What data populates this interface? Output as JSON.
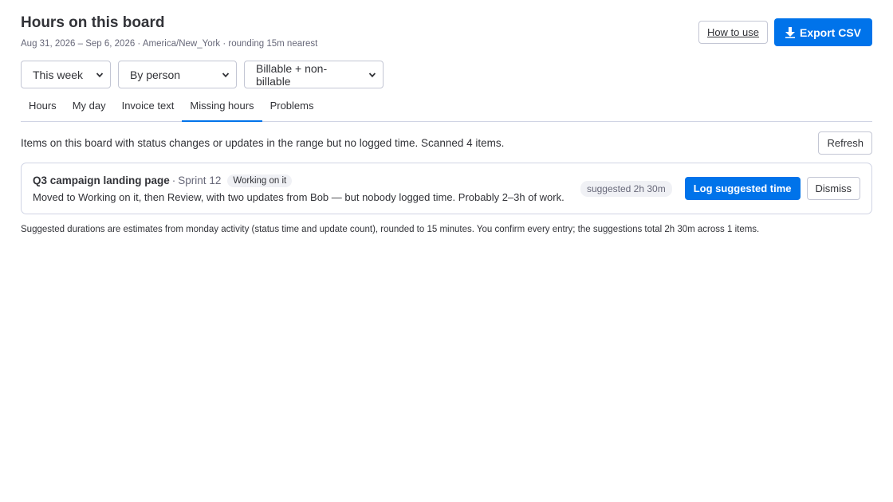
{
  "header": {
    "title": "Hours on this board",
    "subtitle": "Aug 31, 2026 – Sep 6, 2026 · America/New_York · rounding 15m nearest",
    "how_to_use_label": "How to use",
    "export_label": "Export CSV"
  },
  "filters": {
    "range": "This week",
    "group_by": "By person",
    "billable": "Billable + non-billable"
  },
  "tabs": [
    {
      "label": "Hours"
    },
    {
      "label": "My day"
    },
    {
      "label": "Invoice text"
    },
    {
      "label": "Missing hours"
    },
    {
      "label": "Problems"
    }
  ],
  "active_tab": "Missing hours",
  "missing": {
    "info": "Items on this board with status changes or updates in the range but no logged time. Scanned 4 items.",
    "refresh_label": "Refresh",
    "items": [
      {
        "name": "Q3 campaign landing page",
        "separator": "·",
        "group": "Sprint 12",
        "status": "Working on it",
        "description": "Moved to Working on it, then Review, with two updates from Bob — but nobody logged time. Probably 2–3h of work.",
        "suggested": "suggested 2h 30m",
        "log_label": "Log suggested time",
        "dismiss_label": "Dismiss"
      }
    ],
    "footnote": "Suggested durations are estimates from monday activity (status time and update count), rounded to 15 minutes. You confirm every entry; the suggestions total 2h 30m across 1 items."
  },
  "colors": {
    "primary": "#0073ea",
    "border": "#c3c6d4",
    "chip_bg": "#f0f1f5",
    "text": "#323338",
    "muted": "#676879"
  },
  "icons": {
    "export": "download-icon",
    "select": "chevron-down-icon"
  }
}
